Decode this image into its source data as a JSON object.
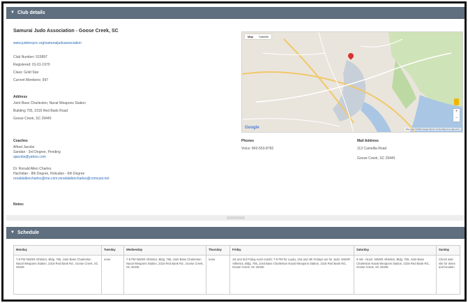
{
  "club_panel": {
    "header": "Club details",
    "title": "Samurai Judo Association - Goose Creek, SC",
    "website": "www.judoinsync.org/samuraijudoassociation",
    "club_number": "Club Number: 515897",
    "registered": "Registered: 01-01-1970",
    "class": "Class: Gold Star",
    "members": "Current Members: 997",
    "address_label": "Address",
    "address_lines": [
      "Joint Base Charleston, Naval Weapons Station",
      "Building 755, 2316 Red Bank Road",
      "Goose Creek, SC 29445"
    ],
    "coaches_label": "Coaches",
    "coach1": [
      "Alfred Jacobs",
      "Sandan - 3rd Degree, Pending"
    ],
    "coach1_email": "ajacobs@yahoo.com",
    "coach2": [
      "Dr. Ronald Allen Charles",
      "Hachidan - 8th Degree, Rokudan - 6th Degree"
    ],
    "coach2_email": "ronaldallencharles@me.com;ronaldallencharles@comcast.net",
    "phones_label": "Phones",
    "phone": "Voice: 843-553-8782",
    "mail_label": "Mail Address",
    "mail_lines": [
      "113 Camellia Road",
      "Goose Creek, SC 29445"
    ],
    "notes_label": "Notes:"
  },
  "map": {
    "tab_map": "Map",
    "tab_satellite": "Satellite",
    "logo": "Google",
    "attribution": "Map data ©2016 Google   Terms of Use   Report a map error",
    "zoom_in": "+",
    "zoom_out": "−",
    "pin_color": "#d8322f"
  },
  "schedule_panel": {
    "header": "Schedule",
    "columns": [
      "Monday",
      "Tuesday",
      "Wednesday",
      "Thursday",
      "Friday",
      "Saturday",
      "Sunday"
    ],
    "cells": [
      "7-9 PM NWSR Athletics, Bldg. 755, Joint Base Charleston Naval Weapons Station, 2316 Red Bank Rd., Goose Creek, SC 29445",
      "none",
      "7-9 PM NWSR Athletics, Bldg. 755, Joint Base Charleston Naval Weapons Station, 2316 Red Bank Rd., Goose Creek, SC 29445",
      "none",
      "1st and 3rd Friday each month: 7-9 PM for Luyku, 2nd and 4th Fridays are for Judo. NWSR Athletics, Bldg. 755, Joint Base Charleston Naval Weapons Station, 2316 Red Bank Rd., Goose Creek, SC 29445",
      "9 AM - Noon: NWSR Athletics, Bldg. 755, Joint Base Charleston Naval Weapons Station, 2316 Red Bank Rd., Goose Creek, SC 29445",
      "Check web site for times and location"
    ]
  },
  "colors": {
    "header_bg": "#5f6f80",
    "link": "#2a6ab4"
  }
}
